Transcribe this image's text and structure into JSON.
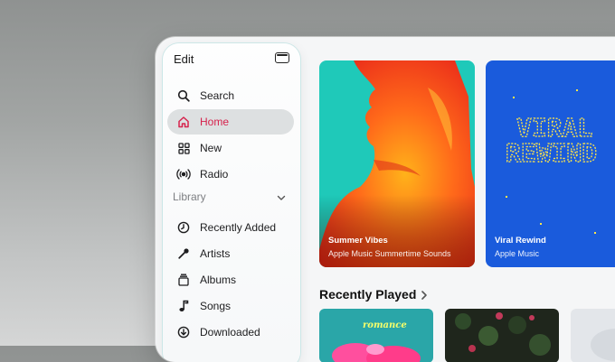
{
  "sidebar": {
    "edit_label": "Edit",
    "toggle_icon": "sidebar-toggle-icon",
    "items": [
      {
        "label": "Search",
        "icon": "search-icon",
        "active": false
      },
      {
        "label": "Home",
        "icon": "home-icon",
        "active": true
      },
      {
        "label": "New",
        "icon": "grid-icon",
        "active": false
      },
      {
        "label": "Radio",
        "icon": "radio-icon",
        "active": false
      }
    ],
    "library": {
      "label": "Library",
      "items": [
        {
          "label": "Recently Added",
          "icon": "clock-icon"
        },
        {
          "label": "Artists",
          "icon": "microphone-icon"
        },
        {
          "label": "Albums",
          "icon": "album-icon"
        },
        {
          "label": "Songs",
          "icon": "music-note-icon"
        },
        {
          "label": "Downloaded",
          "icon": "download-icon"
        }
      ]
    }
  },
  "featured": [
    {
      "title": "Summer Vibes",
      "subtitle": "Apple Music Summertime Sounds"
    },
    {
      "title": "Viral Rewind",
      "subtitle": "Apple Music",
      "art_text": [
        "VIRAL",
        "REWIND"
      ]
    }
  ],
  "recently_played": {
    "title": "Recently Played",
    "tiles": [
      {
        "art_text": "romance"
      },
      {
        "art_text": ""
      },
      {
        "art_text": ""
      }
    ]
  },
  "colors": {
    "accent": "#d6224c",
    "active_bg": "#dde0e1"
  }
}
